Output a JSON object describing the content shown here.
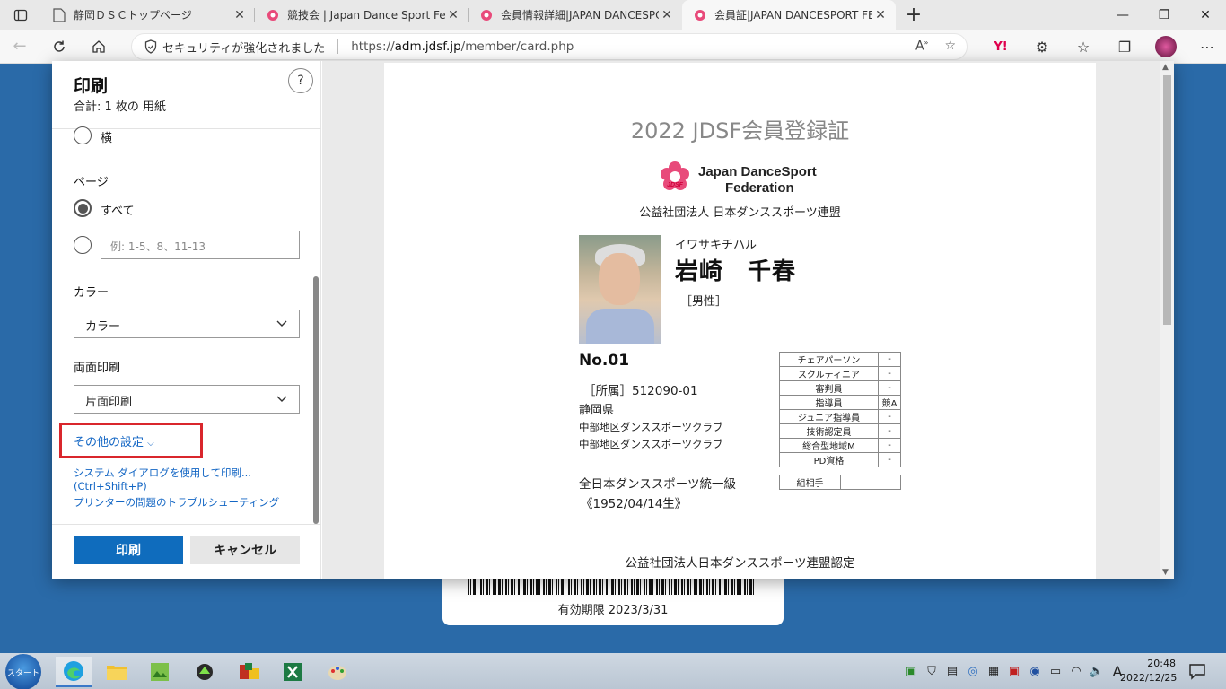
{
  "browser": {
    "tabs": [
      {
        "title": "静岡ＤＳＣトップページ",
        "active": false
      },
      {
        "title": "競技会 | Japan Dance Sport Fede",
        "active": false
      },
      {
        "title": "会員情報詳細|JAPAN DANCESPO",
        "active": false
      },
      {
        "title": "会員証|JAPAN DANCESPORT FED",
        "active": true
      }
    ],
    "security_label": "セキュリティが強化されました",
    "url_prefix": "https://",
    "url_host": "adm.jdsf.jp",
    "url_path": "/member/card.php"
  },
  "print_dialog": {
    "title": "印刷",
    "subtitle": "合計: 1 枚の 用紙",
    "help_label": "?",
    "orientation_landscape": "横",
    "pages_heading": "ページ",
    "pages_all": "すべて",
    "pages_custom_placeholder": "例: 1-5、8、11-13",
    "color_heading": "カラー",
    "color_value": "カラー",
    "duplex_heading": "両面印刷",
    "duplex_value": "片面印刷",
    "more_settings": "その他の設定",
    "system_dialog_link": "システム ダイアログを使用して印刷... (Ctrl+Shift+P)",
    "troubleshoot_link": "プリンターの問題のトラブルシューティング",
    "print_button": "印刷",
    "cancel_button": "キャンセル"
  },
  "card": {
    "title": "2022 JDSF会員登録証",
    "logo_line1": "Japan DanceSport",
    "logo_line2": "Federation",
    "logo_badge": "JDSF",
    "org": "公益社団法人 日本ダンススポーツ連盟",
    "name_kana": "イワサキチハル",
    "name": "岩崎　千春",
    "gender": "［男性］",
    "member_no": "No.01",
    "affiliation": "［所属］512090-01",
    "prefecture": "静岡県",
    "club1": "中部地区ダンススポーツクラブ",
    "club2": "中部地区ダンススポーツクラブ",
    "grade": "全日本ダンススポーツ統一級",
    "birth": "《1952/04/14生》",
    "qualifications": [
      {
        "k": "チェアパーソン",
        "v": "-"
      },
      {
        "k": "スクルティニア",
        "v": "-"
      },
      {
        "k": "審判員",
        "v": "-"
      },
      {
        "k": "指導員",
        "v": "競A"
      },
      {
        "k": "ジュニア指導員",
        "v": "-"
      },
      {
        "k": "技術認定員",
        "v": "-"
      },
      {
        "k": "総合型地域M",
        "v": "-"
      },
      {
        "k": "PD資格",
        "v": "-"
      }
    ],
    "partner_label": "組相手",
    "certify": "公益社団法人日本ダンススポーツ連盟認定"
  },
  "background_card": {
    "expiry": "有効期限  2023/3/31"
  },
  "taskbar": {
    "start_label": "スタート",
    "ime": "A",
    "time": "20:48",
    "date": "2022/12/25"
  },
  "colors": {
    "accent": "#0f6cbd",
    "highlight_box": "#d9262c",
    "desktop": "#2a6aa8"
  }
}
